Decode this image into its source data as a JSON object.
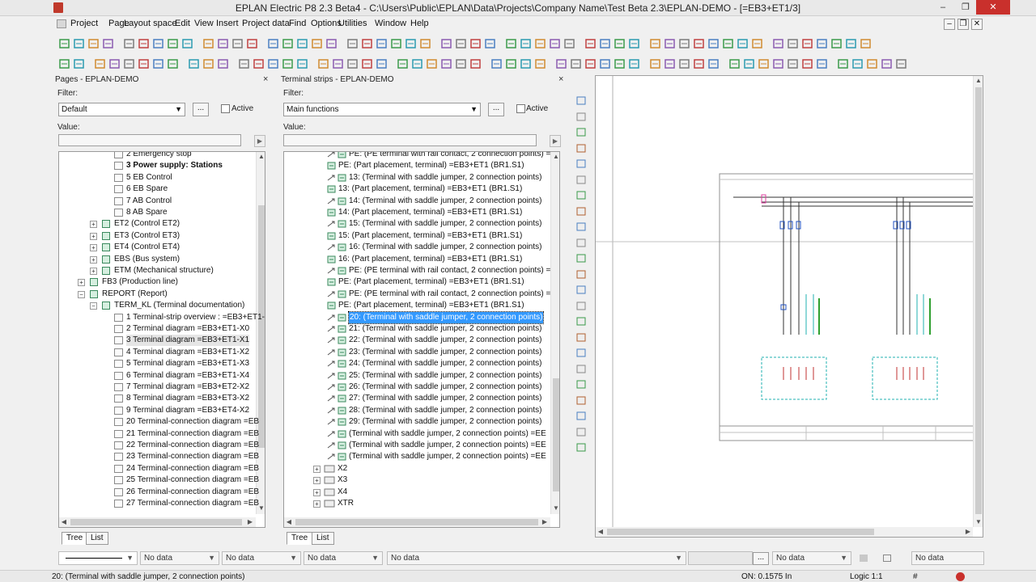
{
  "window": {
    "title": "EPLAN Electric P8 2.3 Beta4 - C:\\Users\\Public\\EPLAN\\Data\\Projects\\Company Name\\Test Beta 2.3\\EPLAN-DEMO - [=EB3+ET1/3]",
    "minimize": "–",
    "restore": "❐",
    "close": "✕"
  },
  "menu": [
    "Project",
    "Page",
    "Layout space",
    "Edit",
    "View",
    "Insert",
    "Project data",
    "Find",
    "Options",
    "Utilities",
    "Window",
    "Help"
  ],
  "mdi": {
    "min": "–",
    "restore": "❐",
    "close": "✕"
  },
  "pages_panel": {
    "title": "Pages - EPLAN-DEMO",
    "close": "×",
    "filter_label": "Filter:",
    "filter_value": "Default",
    "more": "...",
    "active_label": "Active",
    "value_label": "Value:",
    "tabs": [
      "Tree",
      "List"
    ],
    "rows": [
      {
        "t": "2 Emergency stop",
        "lvl": 3,
        "ic": "page"
      },
      {
        "t": "3 Power supply: Stations",
        "lvl": 3,
        "ic": "page",
        "bold": true
      },
      {
        "t": "5 EB Control",
        "lvl": 3,
        "ic": "page"
      },
      {
        "t": "6 EB Spare",
        "lvl": 3,
        "ic": "page"
      },
      {
        "t": "7 AB Control",
        "lvl": 3,
        "ic": "page"
      },
      {
        "t": "8 AB Spare",
        "lvl": 3,
        "ic": "page"
      },
      {
        "t": "ET2 (Control ET2)",
        "lvl": 2,
        "ic": "loc",
        "plus": "+"
      },
      {
        "t": "ET3 (Control ET3)",
        "lvl": 2,
        "ic": "loc",
        "plus": "+"
      },
      {
        "t": "ET4 (Control ET4)",
        "lvl": 2,
        "ic": "loc",
        "plus": "+"
      },
      {
        "t": "EBS (Bus system)",
        "lvl": 2,
        "ic": "loc",
        "plus": "+"
      },
      {
        "t": "ETM (Mechanical structure)",
        "lvl": 2,
        "ic": "loc",
        "plus": "+"
      },
      {
        "t": "FB3 (Production line)",
        "lvl": 1,
        "ic": "func",
        "plus": "+"
      },
      {
        "t": "REPORT (Report)",
        "lvl": 1,
        "ic": "func",
        "plus": "−"
      },
      {
        "t": "TERM_KL (Terminal documentation)",
        "lvl": 2,
        "ic": "loc",
        "plus": "−"
      },
      {
        "t": "1 Terminal-strip overview : =EB3+ET1-",
        "lvl": 3,
        "ic": "page"
      },
      {
        "t": "2 Terminal diagram =EB3+ET1-X0",
        "lvl": 3,
        "ic": "page"
      },
      {
        "t": "3 Terminal diagram =EB3+ET1-X1",
        "lvl": 3,
        "ic": "page",
        "hl": true
      },
      {
        "t": "4 Terminal diagram =EB3+ET1-X2",
        "lvl": 3,
        "ic": "page"
      },
      {
        "t": "5 Terminal diagram =EB3+ET1-X3",
        "lvl": 3,
        "ic": "page"
      },
      {
        "t": "6 Terminal diagram =EB3+ET1-X4",
        "lvl": 3,
        "ic": "page"
      },
      {
        "t": "7 Terminal diagram =EB3+ET2-X2",
        "lvl": 3,
        "ic": "page"
      },
      {
        "t": "8 Terminal diagram =EB3+ET3-X2",
        "lvl": 3,
        "ic": "page"
      },
      {
        "t": "9 Terminal diagram =EB3+ET4-X2",
        "lvl": 3,
        "ic": "page"
      },
      {
        "t": "20 Terminal-connection diagram =EB",
        "lvl": 3,
        "ic": "page"
      },
      {
        "t": "21 Terminal-connection diagram =EB",
        "lvl": 3,
        "ic": "page"
      },
      {
        "t": "22 Terminal-connection diagram =EB",
        "lvl": 3,
        "ic": "page"
      },
      {
        "t": "23 Terminal-connection diagram =EB",
        "lvl": 3,
        "ic": "page"
      },
      {
        "t": "24 Terminal-connection diagram =EB",
        "lvl": 3,
        "ic": "page"
      },
      {
        "t": "25 Terminal-connection diagram =EB",
        "lvl": 3,
        "ic": "page"
      },
      {
        "t": "26 Terminal-connection diagram =EB",
        "lvl": 3,
        "ic": "page"
      },
      {
        "t": "27 Terminal-connection diagram =EB",
        "lvl": 3,
        "ic": "page"
      }
    ]
  },
  "strips_panel": {
    "title": "Terminal strips - EPLAN-DEMO",
    "close": "×",
    "filter_label": "Filter:",
    "filter_value": "Main functions",
    "more": "...",
    "active_label": "Active",
    "value_label": "Value:",
    "tabs": [
      "Tree",
      "List"
    ],
    "rows": [
      {
        "t": "PE: (PE terminal with rail contact, 2 connection points) =",
        "ind": 1
      },
      {
        "t": "PE: (Part placement, terminal) =EB3+ET1 (BR1.S1)",
        "ind": 0
      },
      {
        "t": "13: (Terminal with saddle jumper, 2 connection points)",
        "ind": 1
      },
      {
        "t": "13: (Part placement, terminal) =EB3+ET1 (BR1.S1)",
        "ind": 0
      },
      {
        "t": "14: (Terminal with saddle jumper, 2 connection points)",
        "ind": 1
      },
      {
        "t": "14: (Part placement, terminal) =EB3+ET1 (BR1.S1)",
        "ind": 0
      },
      {
        "t": "15: (Terminal with saddle jumper, 2 connection points)",
        "ind": 1
      },
      {
        "t": "15: (Part placement, terminal) =EB3+ET1 (BR1.S1)",
        "ind": 0
      },
      {
        "t": "16: (Terminal with saddle jumper, 2 connection points)",
        "ind": 1
      },
      {
        "t": "16: (Part placement, terminal) =EB3+ET1 (BR1.S1)",
        "ind": 0
      },
      {
        "t": "PE: (PE terminal with rail contact, 2 connection points) =",
        "ind": 1
      },
      {
        "t": "PE: (Part placement, terminal) =EB3+ET1 (BR1.S1)",
        "ind": 0
      },
      {
        "t": "PE: (PE terminal with rail contact, 2 connection points) =",
        "ind": 1
      },
      {
        "t": "PE: (Part placement, terminal) =EB3+ET1 (BR1.S1)",
        "ind": 0
      },
      {
        "t": "20: (Terminal with saddle jumper, 2 connection points)",
        "ind": 1,
        "sel": true
      },
      {
        "t": "21: (Terminal with saddle jumper, 2 connection points)",
        "ind": 1
      },
      {
        "t": "22: (Terminal with saddle jumper, 2 connection points)",
        "ind": 1
      },
      {
        "t": "23: (Terminal with saddle jumper, 2 connection points)",
        "ind": 1
      },
      {
        "t": "24: (Terminal with saddle jumper, 2 connection points)",
        "ind": 1
      },
      {
        "t": "25: (Terminal with saddle jumper, 2 connection points)",
        "ind": 1
      },
      {
        "t": "26: (Terminal with saddle jumper, 2 connection points)",
        "ind": 1
      },
      {
        "t": "27: (Terminal with saddle jumper, 2 connection points)",
        "ind": 1
      },
      {
        "t": "28: (Terminal with saddle jumper, 2 connection points)",
        "ind": 1
      },
      {
        "t": "29: (Terminal with saddle jumper, 2 connection points)",
        "ind": 1
      },
      {
        "t": "(Terminal with saddle jumper, 2 connection points) =EE",
        "ind": 1
      },
      {
        "t": "(Terminal with saddle jumper, 2 connection points) =EE",
        "ind": 1
      },
      {
        "t": "(Terminal with saddle jumper, 2 connection points) =EE",
        "ind": 1
      }
    ],
    "strips": [
      "X2",
      "X3",
      "X4",
      "XTR"
    ]
  },
  "propbar": [
    "No data",
    "No data",
    "No data",
    "No data",
    "No data",
    "No data"
  ],
  "status": {
    "left": "20: (Terminal with saddle jumper, 2 connection points)",
    "on": "ON: 0.1575 In",
    "logic": "Logic 1:1",
    "hash": "#"
  },
  "colors": {
    "accent": "#3399ff",
    "close": "#c9302c",
    "pink": "#e040a0",
    "cyan": "#20b0b0",
    "green": "#30a030"
  }
}
